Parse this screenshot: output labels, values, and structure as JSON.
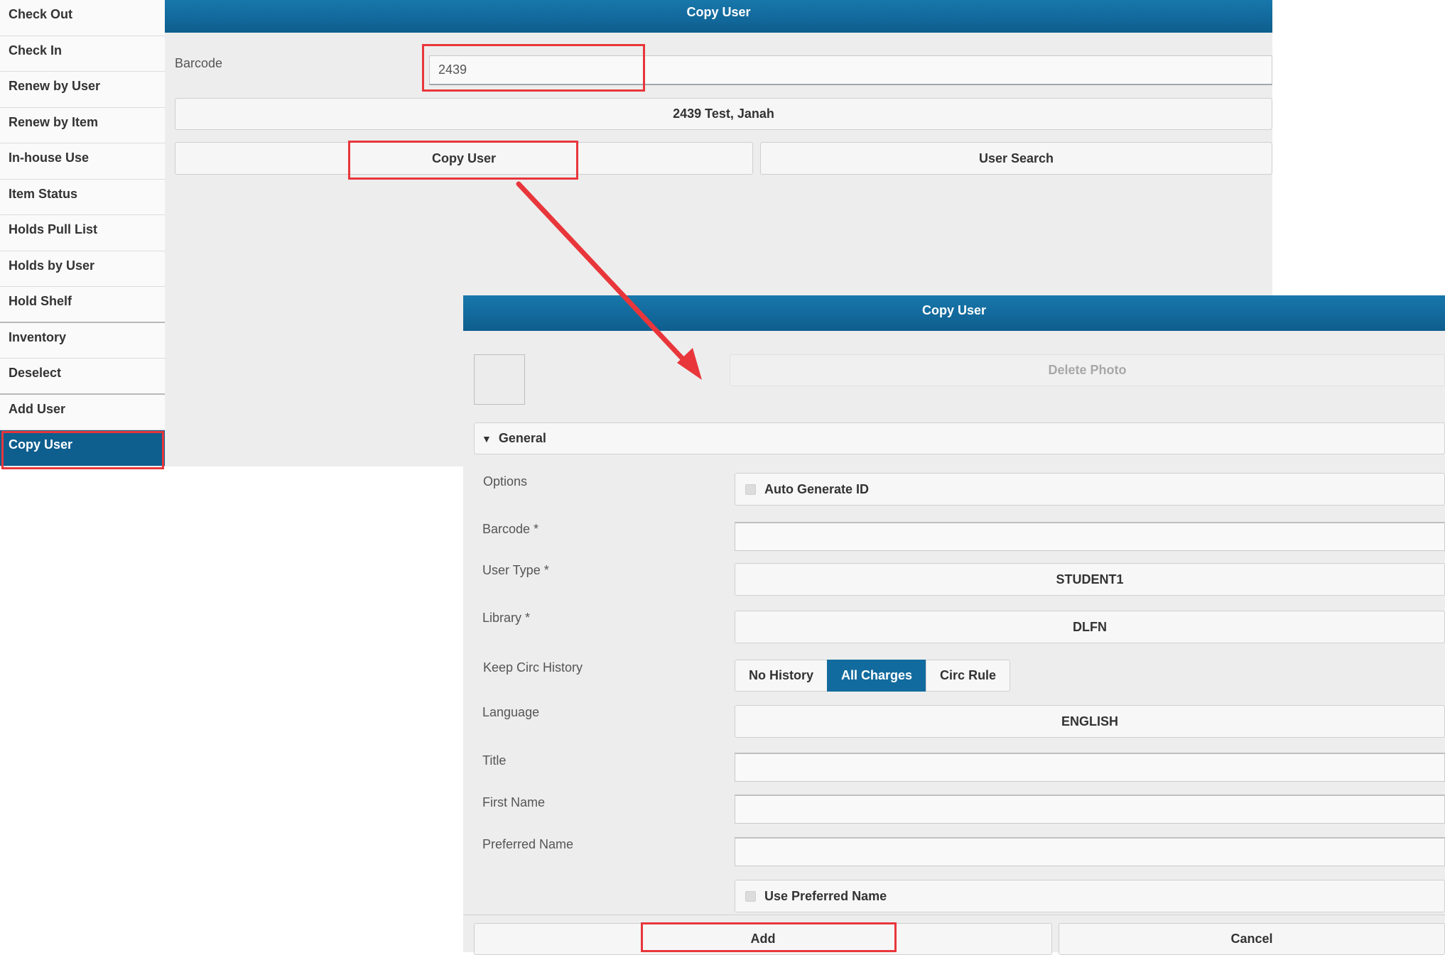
{
  "sidebar": {
    "items": [
      {
        "label": "Check Out"
      },
      {
        "label": "Check In"
      },
      {
        "label": "Renew by User"
      },
      {
        "label": "Renew by Item"
      },
      {
        "label": "In-house Use"
      },
      {
        "label": "Item Status"
      },
      {
        "label": "Holds Pull List"
      },
      {
        "label": "Holds by User"
      },
      {
        "label": "Hold Shelf"
      },
      {
        "label": "Inventory"
      },
      {
        "label": "Deselect"
      },
      {
        "label": "Add User"
      },
      {
        "label": "Copy User"
      }
    ],
    "active": "Copy User"
  },
  "top_panel": {
    "title": "Copy User",
    "barcode_label": "Barcode",
    "barcode_value": "2439",
    "user_display": "2439 Test, Janah",
    "copy_user_button": "Copy User",
    "user_search_button": "User Search"
  },
  "dialog": {
    "title": "Copy User",
    "delete_photo_button": "Delete Photo",
    "section_title": "General",
    "section_toggle_icon": "triangle-down-icon",
    "fields": {
      "options_label": "Options",
      "auto_generate_label": "Auto Generate ID",
      "barcode_label": "Barcode *",
      "barcode_value": "",
      "user_type_label": "User Type *",
      "user_type_value": "STUDENT1",
      "library_label": "Library *",
      "library_value": "DLFN",
      "keep_circ_history_label": "Keep Circ History",
      "circ_history_options": [
        "No History",
        "All Charges",
        "Circ Rule"
      ],
      "circ_history_selected": "All Charges",
      "language_label": "Language",
      "language_value": "ENGLISH",
      "title_label": "Title",
      "title_value": "",
      "first_name_label": "First Name",
      "first_name_value": "",
      "preferred_name_label": "Preferred Name",
      "preferred_name_value": "",
      "use_preferred_name_label": "Use Preferred Name"
    },
    "add_button": "Add",
    "cancel_button": "Cancel"
  },
  "colors": {
    "header_blue": "#0e5e8e",
    "highlight_red": "#e8363b",
    "panel_bg": "#ededed"
  }
}
